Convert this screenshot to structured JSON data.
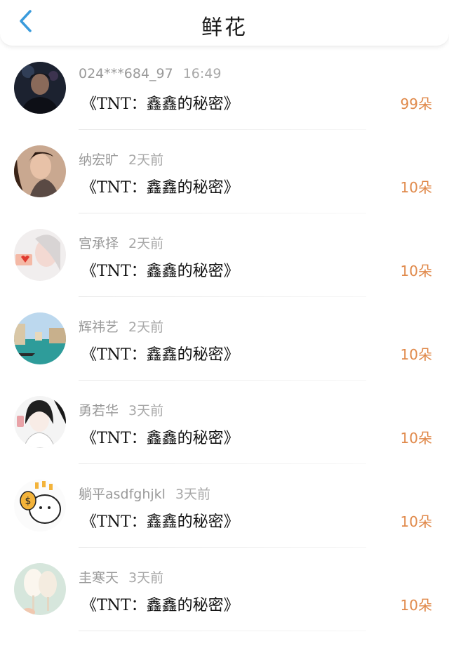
{
  "header": {
    "title": "鲜花"
  },
  "colors": {
    "accent": "#3a9bdc",
    "count": "#e0894a"
  },
  "records": [
    {
      "user": "024***684_97",
      "time": "16:49",
      "gift": "《TNT：鑫鑫的秘密》",
      "count": "99朵"
    },
    {
      "user": "纳宏旷",
      "time": "2天前",
      "gift": "《TNT：鑫鑫的秘密》",
      "count": "10朵"
    },
    {
      "user": "宫承择",
      "time": "2天前",
      "gift": "《TNT：鑫鑫的秘密》",
      "count": "10朵"
    },
    {
      "user": "辉祎艺",
      "time": "2天前",
      "gift": "《TNT：鑫鑫的秘密》",
      "count": "10朵"
    },
    {
      "user": "勇若华",
      "time": "3天前",
      "gift": "《TNT：鑫鑫的秘密》",
      "count": "10朵"
    },
    {
      "user": "躺平asdfghjkl",
      "time": "3天前",
      "gift": "《TNT：鑫鑫的秘密》",
      "count": "10朵"
    },
    {
      "user": "圭寒天",
      "time": "3天前",
      "gift": "《TNT：鑫鑫的秘密》",
      "count": "10朵"
    }
  ]
}
